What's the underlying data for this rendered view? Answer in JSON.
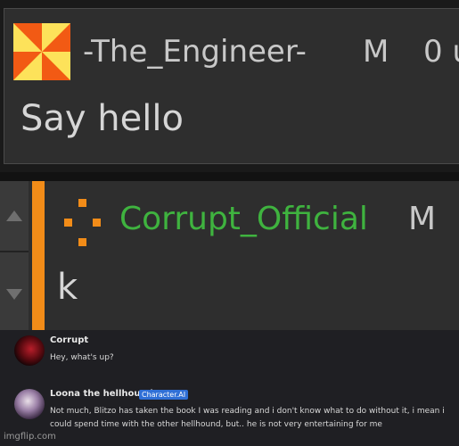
{
  "comment1": {
    "username": "-The_Engineer-",
    "badge": "M",
    "points": "0 u",
    "text": "Say hello",
    "avatar_icon": "pinwheel-avatar-icon"
  },
  "comment2": {
    "username": "Corrupt_Official",
    "badge": "M",
    "text": "k",
    "accent_color": "#f28c18",
    "username_color": "#3fb33f"
  },
  "chat": {
    "messages": [
      {
        "name": "Corrupt",
        "tag": "",
        "text": "Hey, what's up?"
      },
      {
        "name": "Loona the hellhound",
        "tag": "Character.AI",
        "text": "Not much, Blitzo has taken the book I was reading and i don't know what to do without it, i mean i could spend time with the other hellhound, but.. he is not very entertaining for me"
      }
    ]
  },
  "watermark": "imgflip.com"
}
